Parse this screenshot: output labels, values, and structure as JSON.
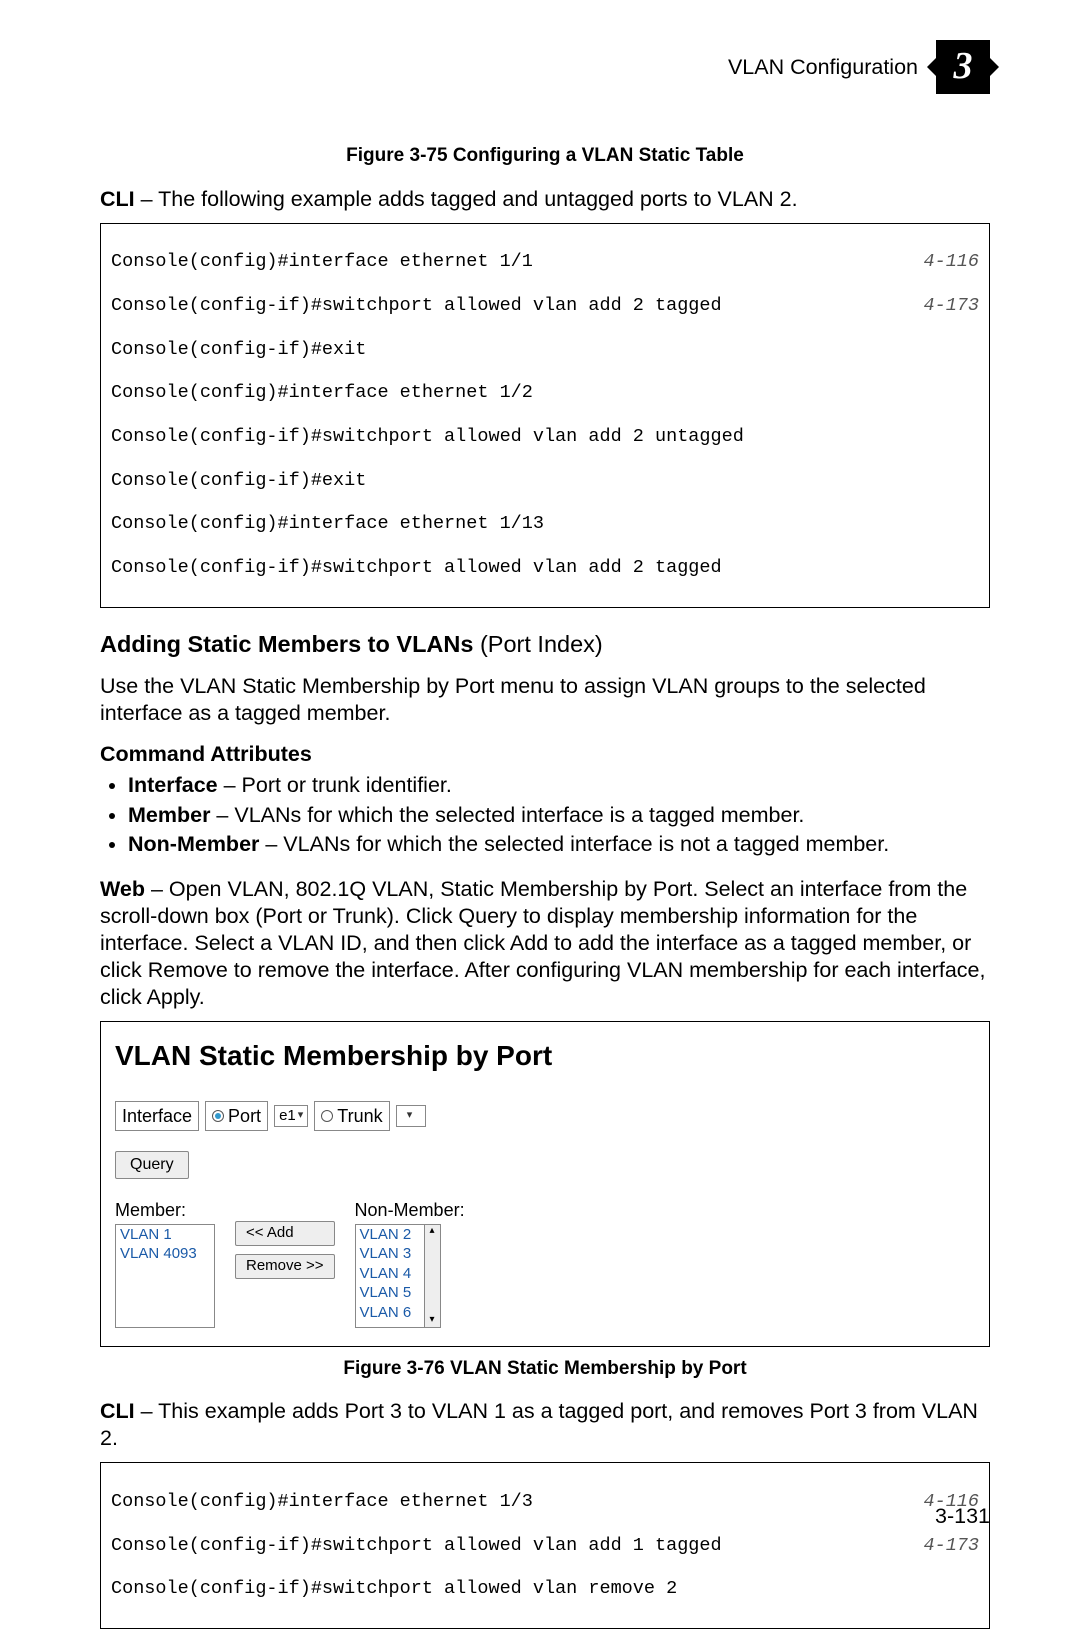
{
  "header": {
    "title": "VLAN Configuration",
    "chapter": "3"
  },
  "figure75_caption": "Figure 3-75  Configuring a VLAN Static Table",
  "cli1_intro_bold": "CLI",
  "cli1_intro_rest": " – The following example adds tagged and untagged ports to VLAN 2.",
  "cli1_lines": [
    {
      "text": "Console(config)#interface ethernet 1/1",
      "ref": "4-116"
    },
    {
      "text": "Console(config-if)#switchport allowed vlan add 2 tagged",
      "ref": "4-173"
    },
    {
      "text": "Console(config-if)#exit",
      "ref": ""
    },
    {
      "text": "Console(config)#interface ethernet 1/2",
      "ref": ""
    },
    {
      "text": "Console(config-if)#switchport allowed vlan add 2 untagged",
      "ref": ""
    },
    {
      "text": "Console(config-if)#exit",
      "ref": ""
    },
    {
      "text": "Console(config)#interface ethernet 1/13",
      "ref": ""
    },
    {
      "text": "Console(config-if)#switchport allowed vlan add 2 tagged",
      "ref": ""
    }
  ],
  "section_heading_bold": "Adding Static Members to VLANs",
  "section_heading_light": " (Port Index)",
  "section_intro": "Use the VLAN Static Membership by Port menu to assign VLAN groups to the selected interface as a tagged member.",
  "cmd_attr_heading": "Command Attributes",
  "attrs": {
    "interface_b": "Interface",
    "interface_r": " – Port or trunk identifier.",
    "member_b": "Member",
    "member_r": " – VLANs for which the selected interface is a tagged member.",
    "nonmember_b": "Non-Member",
    "nonmember_r": " – VLANs for which the selected interface is not a tagged member."
  },
  "web_b": "Web",
  "web_r": " – Open VLAN, 802.1Q VLAN, Static Membership by Port. Select an interface from the scroll-down box (Port or Trunk). Click Query to display membership information for the interface. Select a VLAN ID, and then click Add to add the interface as a tagged member, or click Remove to remove the interface. After configuring VLAN membership for each interface, click Apply.",
  "webshot": {
    "title": "VLAN Static Membership by Port",
    "iface_label": "Interface",
    "port_label": "Port",
    "port_value": "e1",
    "trunk_label": "Trunk",
    "query_btn": "Query",
    "member_label": "Member:",
    "nonmember_label": "Non-Member:",
    "member_items": [
      "VLAN 1",
      "VLAN 4093"
    ],
    "nonmember_items": [
      "VLAN 2",
      "VLAN 3",
      "VLAN 4",
      "VLAN 5",
      "VLAN 6"
    ],
    "add_btn": "<< Add",
    "remove_btn": "Remove >>"
  },
  "figure76_caption": "Figure 3-76  VLAN Static Membership by Port",
  "cli2_intro_bold": "CLI",
  "cli2_intro_rest": " – This example adds Port 3 to VLAN 1 as a tagged port, and removes Port 3 from VLAN 2.",
  "cli2_lines": [
    {
      "text": "Console(config)#interface ethernet 1/3",
      "ref": "4-116"
    },
    {
      "text": "Console(config-if)#switchport allowed vlan add 1 tagged",
      "ref": "4-173"
    },
    {
      "text": "Console(config-if)#switchport allowed vlan remove 2",
      "ref": ""
    }
  ],
  "page_number": "3-131"
}
